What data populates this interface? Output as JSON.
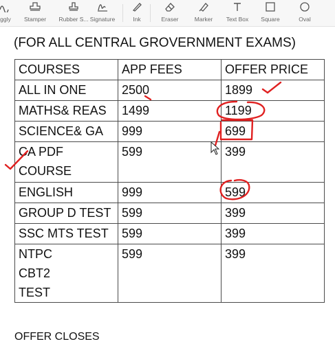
{
  "toolbar": {
    "tools": [
      {
        "label": "iggly",
        "icon": "squiggly-icon"
      },
      {
        "label": "Stamper",
        "icon": "stamper-icon"
      },
      {
        "label": "Rubber S...",
        "icon": "rubber-stamp-icon"
      },
      {
        "label": "Signature",
        "icon": "signature-icon"
      },
      {
        "label": "Ink",
        "icon": "ink-pen-icon"
      },
      {
        "label": "Eraser",
        "icon": "eraser-icon"
      },
      {
        "label": "Marker",
        "icon": "marker-icon"
      },
      {
        "label": "Text Box",
        "icon": "text-box-icon"
      },
      {
        "label": "Square",
        "icon": "square-icon"
      },
      {
        "label": "Oval",
        "icon": "oval-icon"
      }
    ],
    "active_tool": "Ink",
    "ink_color": "#e02020"
  },
  "document": {
    "heading": "(FOR ALL CENTRAL GROVERNMENT EXAMS)",
    "table": {
      "headers": [
        "COURSES",
        "APP FEES",
        "OFFER PRICE"
      ],
      "rows": [
        [
          "ALL IN ONE",
          "2500",
          "1899"
        ],
        [
          "MATHS& REAS",
          "1499",
          "1199"
        ],
        [
          "SCIENCE& GA",
          "999",
          "699"
        ],
        [
          "CA PDF COURSE",
          "599",
          "399"
        ],
        [
          "ENGLISH",
          "999",
          "599"
        ],
        [
          "GROUP D TEST",
          "599",
          "399"
        ],
        [
          "SSC MTS TEST",
          "599",
          "399"
        ],
        [
          "NTPC CBT2 TEST",
          "599",
          "399"
        ]
      ]
    },
    "footer": "OFFER CLOSES"
  }
}
